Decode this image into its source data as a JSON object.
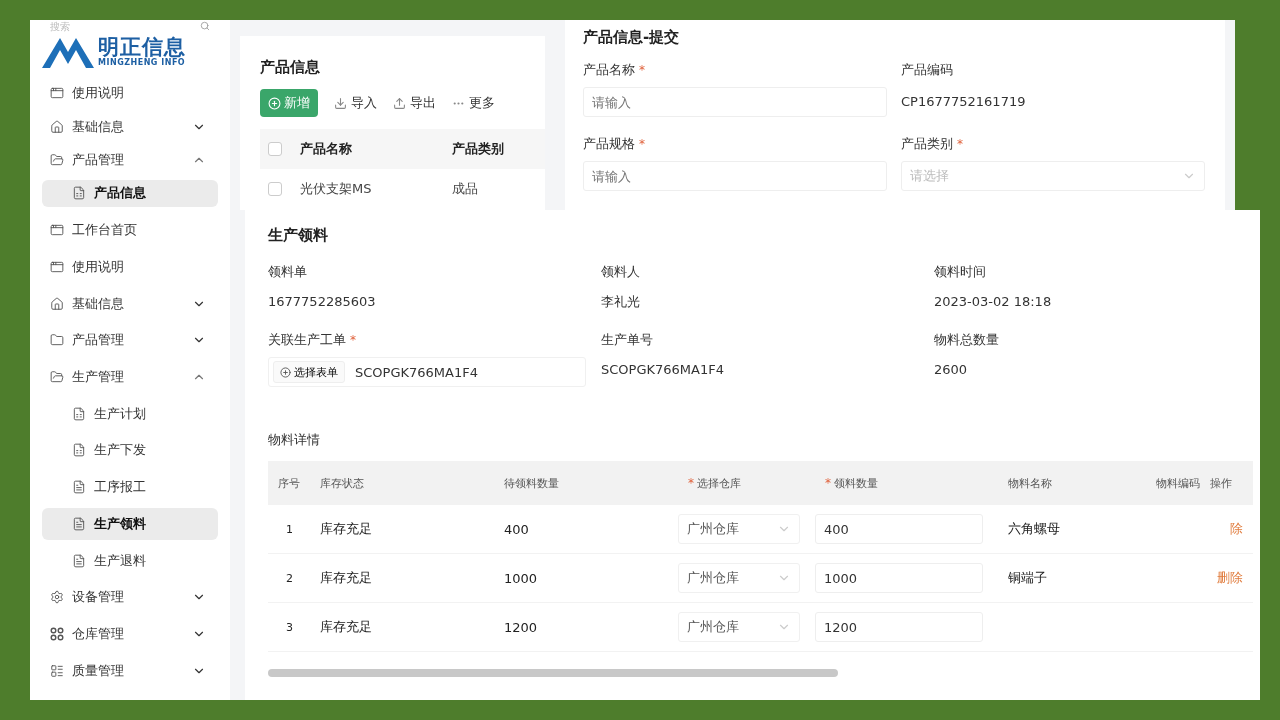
{
  "top_screen": {
    "sidebar": {
      "search_placeholder": "搜索",
      "logo": {
        "title": "明正信息",
        "subtitle": "MINGZHENG INFO"
      },
      "items": [
        {
          "label": "使用说明",
          "kind": "window",
          "selected": false
        },
        {
          "label": "基础信息",
          "kind": "home",
          "selected": false,
          "expanded": false
        },
        {
          "label": "产品管理",
          "kind": "folder-open",
          "selected": false,
          "expanded": true,
          "children": [
            {
              "label": "产品信息",
              "kind": "sheet",
              "selected": true
            }
          ]
        }
      ]
    },
    "product_list": {
      "title": "产品信息",
      "toolbar": [
        {
          "label": "新增",
          "kind": "primary"
        },
        {
          "label": "导入",
          "kind": "import"
        },
        {
          "label": "导出",
          "kind": "export"
        },
        {
          "label": "更多",
          "kind": "more"
        }
      ],
      "header_checked": false,
      "columns": [
        "产品名称",
        "产品类别"
      ],
      "rows": [
        {
          "checked": false,
          "cells": [
            "光伏支架MS",
            "成品"
          ]
        }
      ]
    },
    "product_form": {
      "title": "产品信息-提交",
      "fields": [
        {
          "label": "产品名称",
          "mark": "*",
          "kind": "input",
          "placeholder": "请输入"
        },
        {
          "label": "产品编码",
          "kind": "text",
          "value": "CP1677752161719"
        },
        {
          "label": "产品规格",
          "mark": "*",
          "kind": "input",
          "placeholder": "请输入"
        },
        {
          "label": "产品类别",
          "mark": "*",
          "kind": "select",
          "placeholder": "请选择"
        }
      ]
    }
  },
  "bottom_screen": {
    "sidebar": {
      "items": [
        {
          "label": "工作台首页",
          "kind": "window",
          "selected": false
        },
        {
          "label": "使用说明",
          "kind": "window",
          "selected": false
        },
        {
          "label": "基础信息",
          "kind": "home",
          "selected": false,
          "expanded": false
        },
        {
          "label": "产品管理",
          "kind": "folder",
          "selected": false,
          "expanded": false
        },
        {
          "label": "生产管理",
          "kind": "folder-open",
          "selected": false,
          "expanded": true,
          "children": [
            {
              "label": "生产计划",
              "kind": "sheet",
              "selected": false
            },
            {
              "label": "生产下发",
              "kind": "sheet",
              "selected": false
            },
            {
              "label": "工序报工",
              "kind": "doc",
              "selected": false
            },
            {
              "label": "生产领料",
              "kind": "doc",
              "selected": true
            },
            {
              "label": "生产退料",
              "kind": "doc",
              "selected": false
            }
          ]
        },
        {
          "label": "设备管理",
          "kind": "gear",
          "selected": false,
          "expanded": false
        },
        {
          "label": "仓库管理",
          "kind": "dots",
          "selected": false,
          "expanded": false
        },
        {
          "label": "质量管理",
          "kind": "list",
          "selected": false,
          "expanded": false
        }
      ]
    },
    "requisition": {
      "title": "生产领料",
      "info": [
        {
          "label": "领料单",
          "kind": "text",
          "value": "1677752285603"
        },
        {
          "label": "领料人",
          "kind": "text",
          "value": "李礼光"
        },
        {
          "label": "领料时间",
          "kind": "text",
          "value": "2023-03-02 18:18"
        },
        {
          "label": "关联生产工单",
          "mark": "*",
          "kind": "picker",
          "button": "选择表单",
          "value": "SCOPGK766MA1F4"
        },
        {
          "label": "生产单号",
          "kind": "text",
          "value": "SCOPGK766MA1F4"
        },
        {
          "label": "物料总数量",
          "kind": "text",
          "value": "2600"
        }
      ],
      "details_title": "物料详情",
      "columns": [
        {
          "label": "序号"
        },
        {
          "label": "库存状态"
        },
        {
          "label": "待领料数量"
        },
        {
          "label": "选择仓库",
          "mark": "*"
        },
        {
          "label": "领料数量",
          "mark": "*"
        },
        {
          "label": "物料名称"
        },
        {
          "label": "物料编码"
        },
        {
          "label": "操作"
        }
      ],
      "rows": [
        {
          "index": "1",
          "stock_status": "库存充足",
          "pending": "400",
          "warehouse": "广州仓库",
          "quantity": "400",
          "material": "六角螺母",
          "action": "除"
        },
        {
          "index": "2",
          "stock_status": "库存充足",
          "pending": "1000",
          "warehouse": "广州仓库",
          "quantity": "1000",
          "material": "铜端子",
          "action": "删除"
        },
        {
          "index": "3",
          "stock_status": "库存充足",
          "pending": "1200",
          "warehouse": "广州仓库",
          "quantity": "1200"
        }
      ]
    }
  }
}
